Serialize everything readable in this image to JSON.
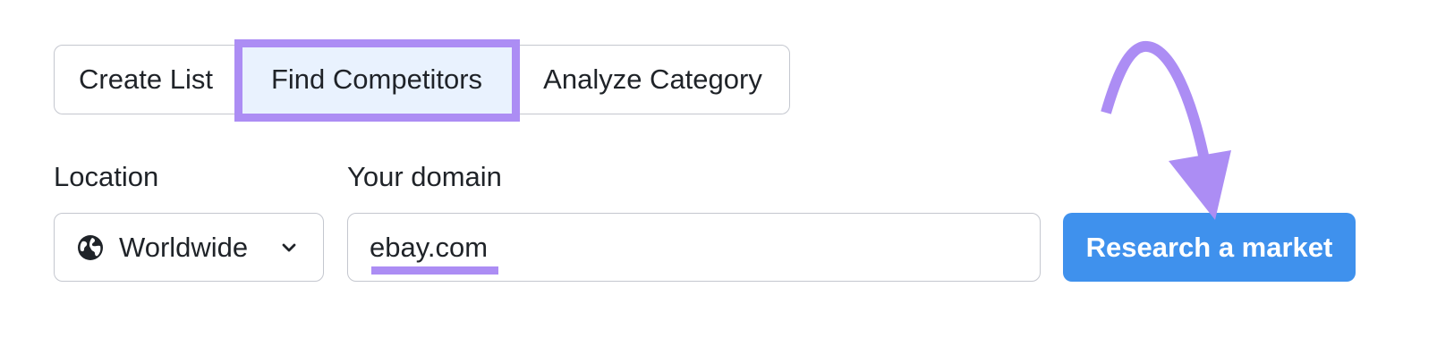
{
  "tabs": [
    {
      "label": "Create List"
    },
    {
      "label": "Find Competitors"
    },
    {
      "label": "Analyze Category"
    }
  ],
  "location": {
    "label": "Location",
    "value": "Worldwide",
    "icon": "globe-icon"
  },
  "domain": {
    "label": "Your domain",
    "value": "ebay.com"
  },
  "button": {
    "label": "Research a market"
  },
  "colors": {
    "highlight": "#ac8df4",
    "active_tab_bg": "#e9f2fe",
    "button_bg": "#3f91ed",
    "border": "#c4c7cf"
  }
}
